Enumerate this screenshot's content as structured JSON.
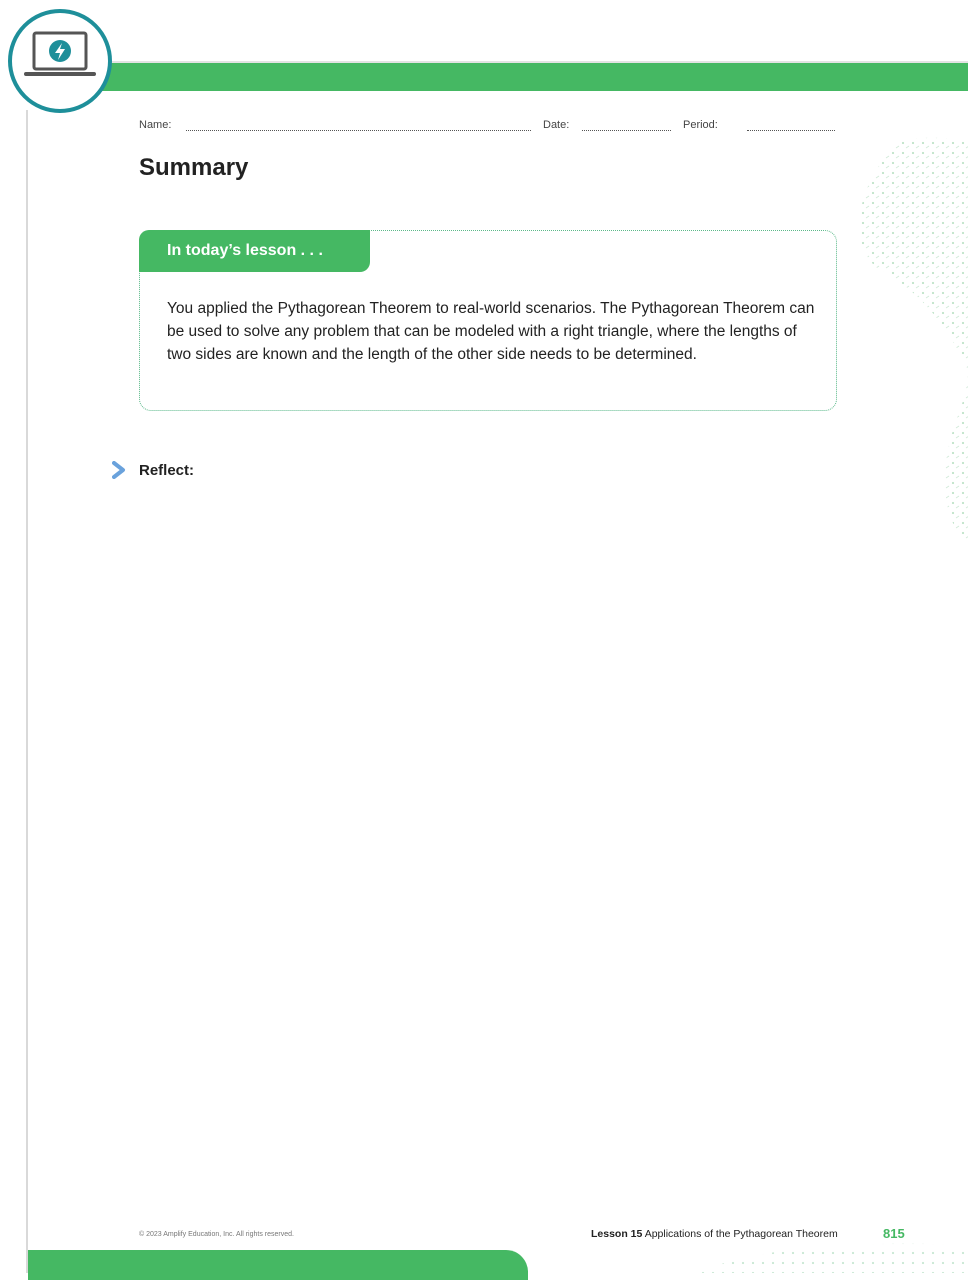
{
  "header": {
    "name_label": "Name:",
    "date_label": "Date:",
    "period_label": "Period:"
  },
  "section_title": "Summary",
  "lesson_box": {
    "tab_label": "In today’s lesson . . .",
    "body": "You applied the Pythagorean Theorem to real-world scenarios. The Pythagorean Theorem can be used to solve any problem that can be modeled with a right triangle, where the lengths of two sides are known and the length of the other side needs to be determined."
  },
  "reflect": {
    "label": "Reflect:"
  },
  "footer": {
    "copyright": "© 2023 Amplify Education, Inc. All rights reserved.",
    "lesson_label": "Lesson 15",
    "lesson_title": "Applications of the Pythagorean Theorem",
    "page_number": "815"
  },
  "icons": {
    "badge": "laptop-lightning-icon",
    "reflect": "chevron-right-icon"
  },
  "colors": {
    "accent_green": "#45b863",
    "badge_teal": "#1e8f9a",
    "chevron_blue": "#6aa2dc"
  }
}
